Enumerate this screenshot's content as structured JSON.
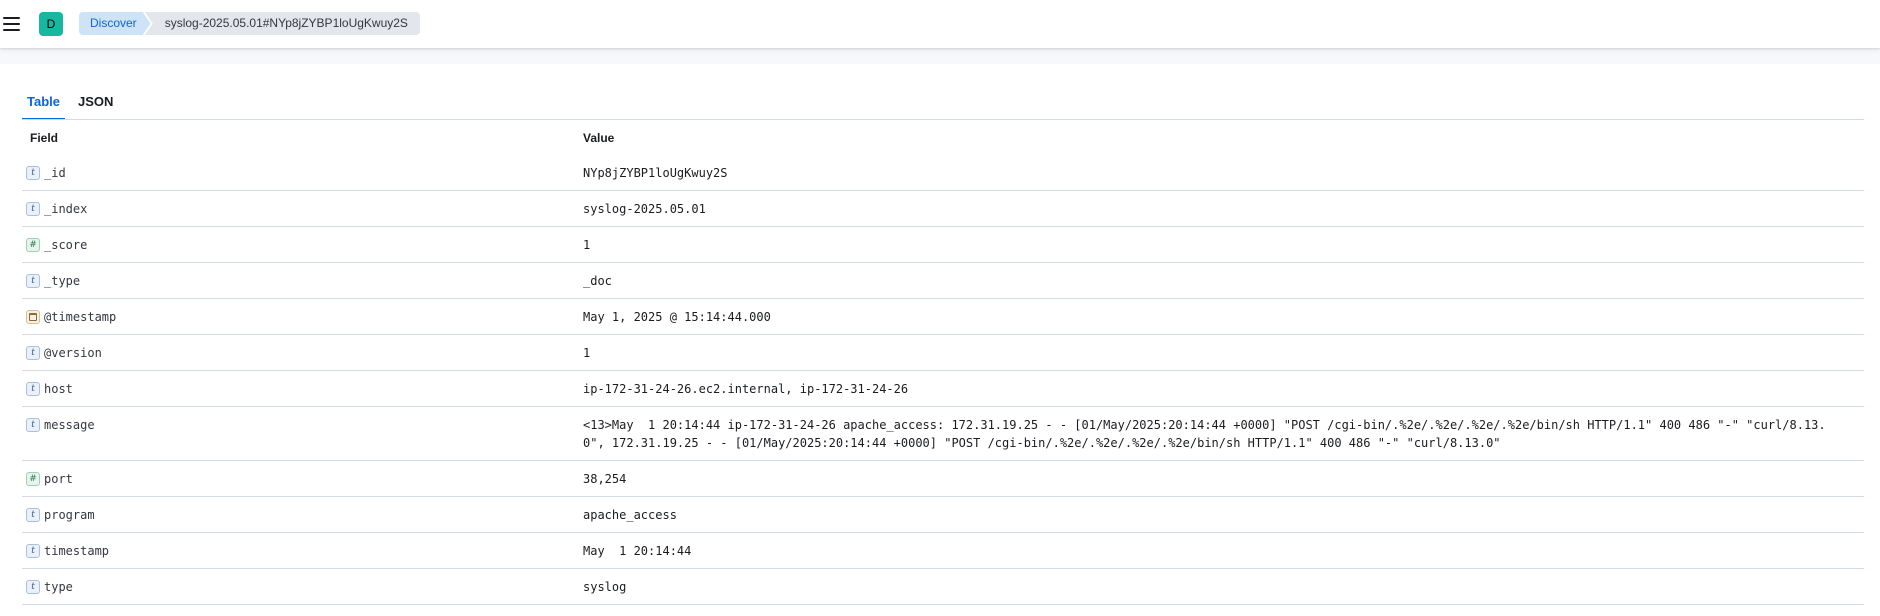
{
  "header": {
    "space_initial": "D",
    "breadcrumbs": [
      "Discover",
      "syslog-2025.05.01#NYp8jZYBP1loUgKwuy2S"
    ]
  },
  "tabs": [
    {
      "label": "Table",
      "active": true
    },
    {
      "label": "JSON",
      "active": false
    }
  ],
  "table": {
    "columns": {
      "field": "Field",
      "value": "Value"
    },
    "rows": [
      {
        "type": "t",
        "type_icon": "string-type-icon",
        "field": "_id",
        "value": "NYp8jZYBP1loUgKwuy2S"
      },
      {
        "type": "t",
        "type_icon": "string-type-icon",
        "field": "_index",
        "value": "syslog-2025.05.01"
      },
      {
        "type": "#",
        "type_icon": "number-type-icon",
        "field": "_score",
        "value": "1"
      },
      {
        "type": "t",
        "type_icon": "string-type-icon",
        "field": "_type",
        "value": "_doc"
      },
      {
        "type": "date",
        "type_icon": "date-type-icon",
        "field": "@timestamp",
        "value": "May 1, 2025 @ 15:14:44.000"
      },
      {
        "type": "t",
        "type_icon": "string-type-icon",
        "field": "@version",
        "value": "1"
      },
      {
        "type": "t",
        "type_icon": "string-type-icon",
        "field": "host",
        "value": "ip-172-31-24-26.ec2.internal, ip-172-31-24-26"
      },
      {
        "type": "t",
        "type_icon": "string-type-icon",
        "field": "message",
        "value": "<13>May  1 20:14:44 ip-172-31-24-26 apache_access: 172.31.19.25 - - [01/May/2025:20:14:44 +0000] \"POST /cgi-bin/.%2e/.%2e/.%2e/.%2e/bin/sh HTTP/1.1\" 400 486 \"-\" \"curl/8.13.0\", 172.31.19.25 - - [01/May/2025:20:14:44 +0000] \"POST /cgi-bin/.%2e/.%2e/.%2e/.%2e/bin/sh HTTP/1.1\" 400 486 \"-\" \"curl/8.13.0\""
      },
      {
        "type": "#",
        "type_icon": "number-type-icon",
        "field": "port",
        "value": "38,254"
      },
      {
        "type": "t",
        "type_icon": "string-type-icon",
        "field": "program",
        "value": "apache_access"
      },
      {
        "type": "t",
        "type_icon": "string-type-icon",
        "field": "timestamp",
        "value": "May  1 20:14:44"
      },
      {
        "type": "t",
        "type_icon": "string-type-icon",
        "field": "type",
        "value": "syslog"
      }
    ]
  },
  "colors": {
    "accent": "#0b64dd",
    "avatar": "#17b8a0",
    "breadcrumb_active_bg": "#cfe3f7",
    "breadcrumb_last_bg": "#e3e6eb",
    "border": "#d3dae6"
  }
}
